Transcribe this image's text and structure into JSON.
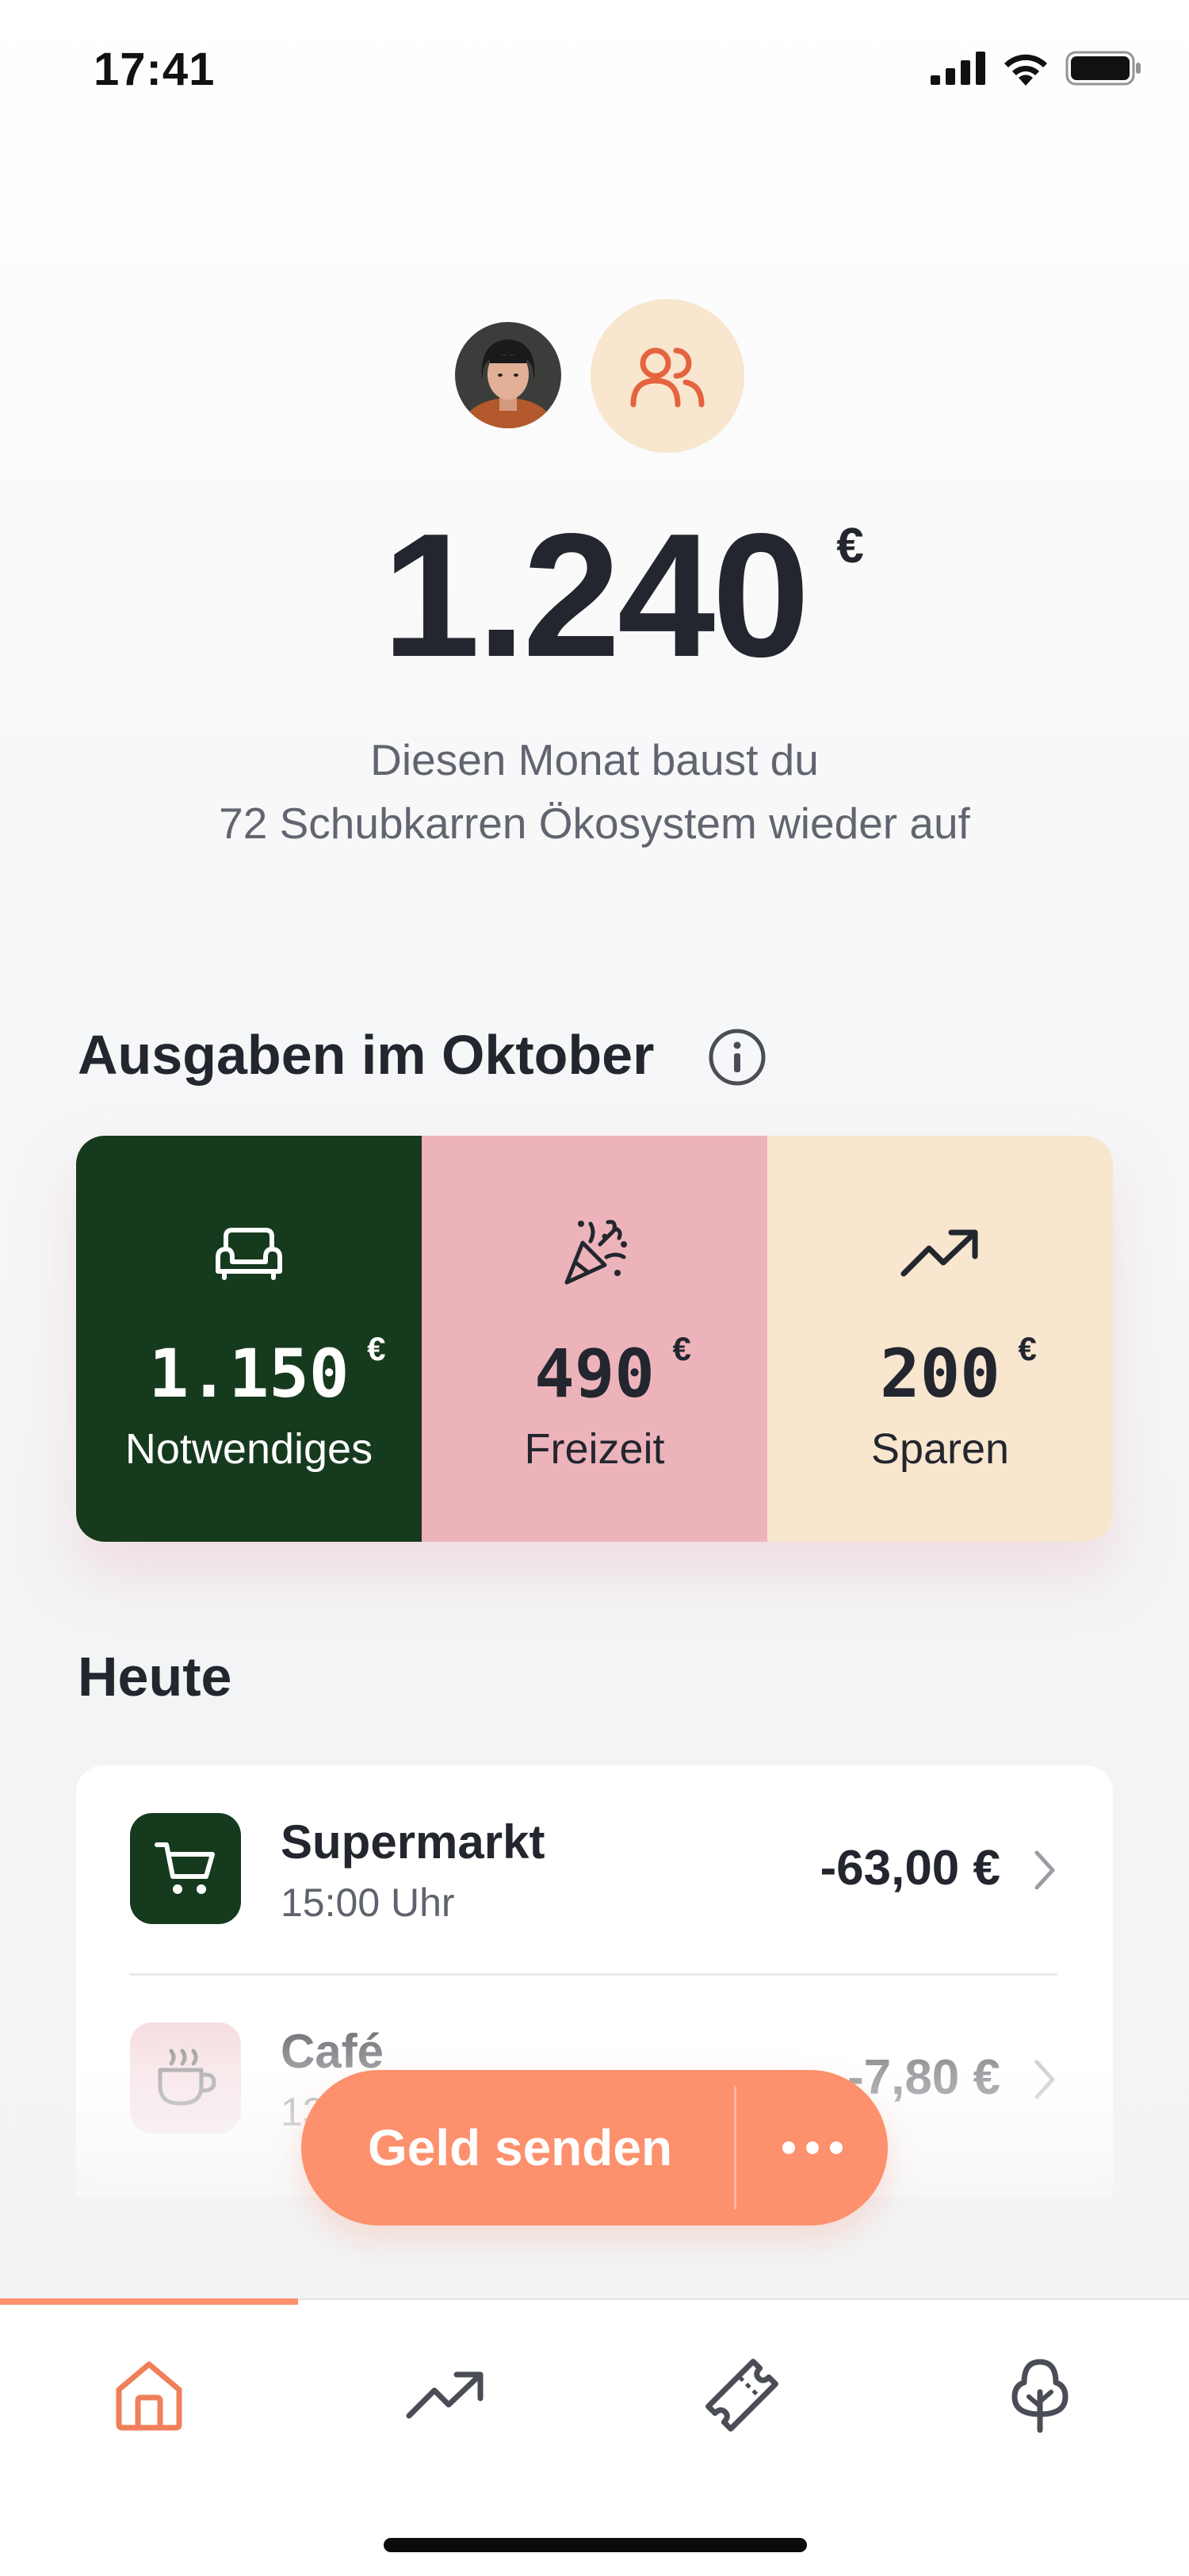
{
  "status_bar": {
    "time": "17:41"
  },
  "header": {
    "avatar_icon": "user-photo",
    "group_icon": "users-icon"
  },
  "balance": {
    "amount": "1.240",
    "currency": "€",
    "subtitle_line1": "Diesen Monat baust du",
    "subtitle_line2": "72 Schubkarren Ökosystem wieder auf"
  },
  "spending": {
    "title": "Ausgaben im Oktober",
    "categories": [
      {
        "value": "1.150",
        "currency": "€",
        "label": "Notwendiges",
        "icon": "sofa-icon",
        "color": "#163a1d"
      },
      {
        "value": "490",
        "currency": "€",
        "label": "Freizeit",
        "icon": "party-popper-icon",
        "color": "#edb3bb"
      },
      {
        "value": "200",
        "currency": "€",
        "label": "Sparen",
        "icon": "trending-up-icon",
        "color": "#f8e6cf"
      }
    ]
  },
  "today": {
    "title": "Heute",
    "transactions": [
      {
        "name": "Supermarkt",
        "time": "15:00 Uhr",
        "amount": "-63,00 €",
        "icon": "shopping-cart-icon"
      },
      {
        "name": "Café",
        "time": "13:00 Uhr",
        "amount": "-7,80 €",
        "icon": "coffee-cup-icon"
      }
    ]
  },
  "actions": {
    "send_label": "Geld senden",
    "more_icon": "more-icon"
  },
  "tabs": [
    {
      "icon": "home-icon",
      "active": true
    },
    {
      "icon": "trending-up-icon",
      "active": false
    },
    {
      "icon": "ticket-icon",
      "active": false
    },
    {
      "icon": "tree-icon",
      "active": false
    }
  ],
  "colors": {
    "accent": "#fd906d",
    "dark_green": "#163a1d",
    "pink": "#edb3bb",
    "cream": "#f8e6cf"
  }
}
